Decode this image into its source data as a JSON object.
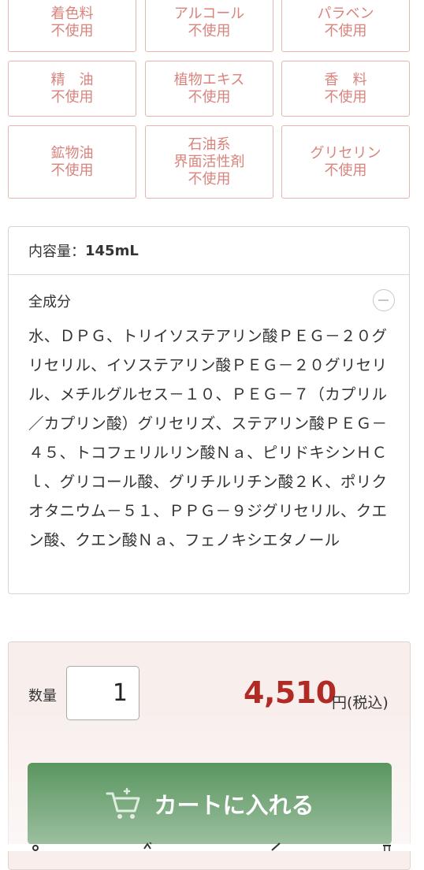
{
  "badges": [
    {
      "lines": [
        "着色料",
        "不使用"
      ]
    },
    {
      "lines": [
        "アルコール",
        "不使用"
      ]
    },
    {
      "lines": [
        "パラベン",
        "不使用"
      ]
    },
    {
      "lines": [
        "精　油",
        "不使用"
      ]
    },
    {
      "lines": [
        "植物エキス",
        "不使用"
      ]
    },
    {
      "lines": [
        "香　料",
        "不使用"
      ]
    },
    {
      "lines": [
        "鉱物油",
        "不使用"
      ]
    },
    {
      "lines": [
        "石油系",
        "界面活性剤",
        "不使用"
      ]
    },
    {
      "lines": [
        "グリセリン",
        "不使用"
      ]
    }
  ],
  "product_info": {
    "volume_label": "内容量：",
    "volume_value": "145mL",
    "ingredients_title": "全成分",
    "ingredients_text": "水、ＤＰＧ、トリイソステアリン酸ＰＥＧ－２０グリセリル、イソステアリン酸ＰＥＧ－２０グリセリル、メチルグルセス－１０、ＰＥＧ－７（カプリル／カプリン酸）グリセリズ、ステアリン酸ＰＥＧ－４５、トコフェリルリン酸Ｎａ、ピリドキシンＨＣｌ、グリコール酸、グリチルリチン酸２Ｋ、ポリクオタニウム－５１、ＰＰＧ－９ジグリセリル、クエン酸、クエン酸Ｎａ、フェノキシエタノール"
  },
  "purchase": {
    "quantity_label": "数量",
    "quantity_value": "1",
    "price": "4,510",
    "price_suffix": "円(税込)",
    "cart_button_label": "カートに入れる"
  },
  "colors": {
    "badge_text": "#d9837c",
    "badge_border": "#e7b4b0",
    "price": "#b02a26",
    "cart_button": "#2f7a36",
    "purchase_bg": "#f8efed"
  }
}
